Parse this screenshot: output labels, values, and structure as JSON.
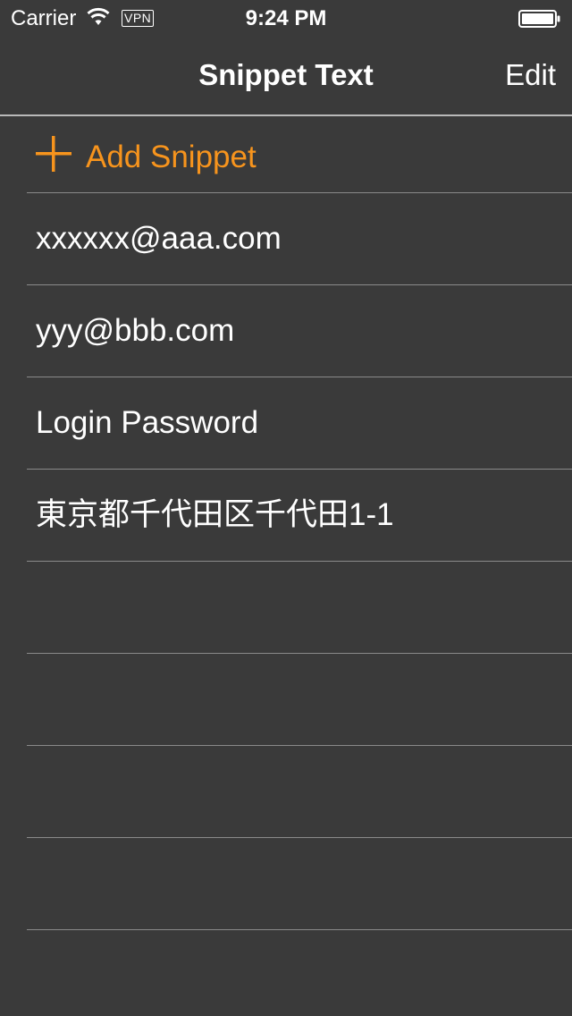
{
  "status_bar": {
    "carrier": "Carrier",
    "vpn": "VPN",
    "time": "9:24 PM"
  },
  "nav": {
    "title": "Snippet Text",
    "edit_label": "Edit"
  },
  "add_row": {
    "label": "Add Snippet",
    "accent_color": "#f7941d",
    "icon": "plus-icon"
  },
  "snippets": [
    {
      "text": "xxxxxx@aaa.com"
    },
    {
      "text": "yyy@bbb.com"
    },
    {
      "text": "Login Password"
    },
    {
      "text": "東京都千代田区千代田1-1"
    },
    {
      "text": ""
    },
    {
      "text": ""
    },
    {
      "text": ""
    },
    {
      "text": ""
    }
  ],
  "colors": {
    "background": "#3a3a3a",
    "accent": "#f7941d",
    "separator": "#8a8a8a"
  }
}
